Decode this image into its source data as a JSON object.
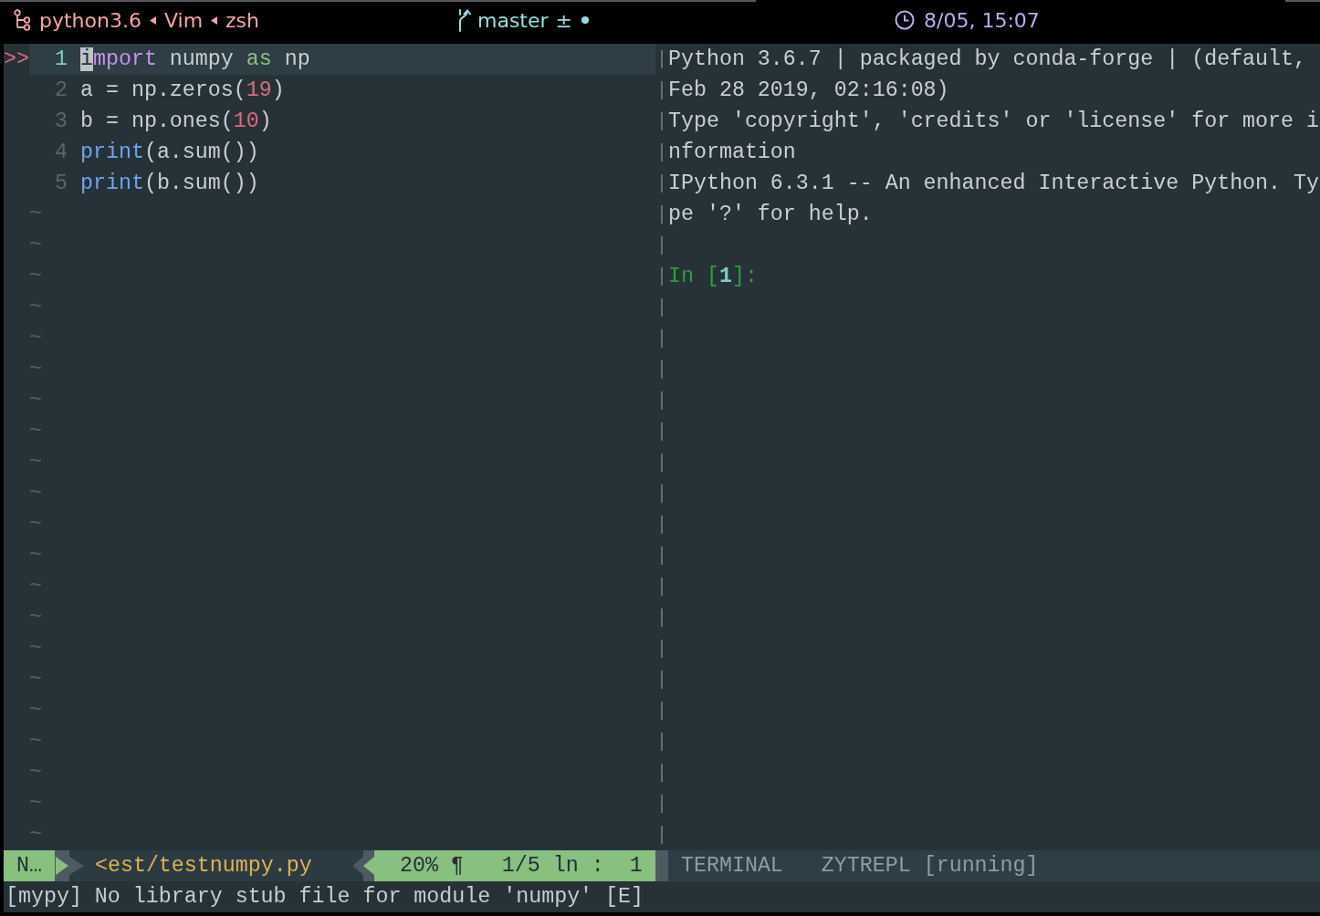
{
  "tmux_bar": {
    "process_chain": [
      "python3.6",
      "Vim",
      "zsh"
    ],
    "git": {
      "branch": "master",
      "status": "±",
      "changes_dot": true
    },
    "clock": "8/05, 15:07"
  },
  "editor": {
    "lines": [
      {
        "number": "1",
        "sign": ">>",
        "current": true,
        "tokens": [
          {
            "text": "i",
            "kind": "keyword",
            "cursor": true
          },
          {
            "text": "mport",
            "kind": "keyword",
            "cursor": false
          },
          {
            "text": " numpy ",
            "kind": "plain",
            "cursor": false
          },
          {
            "text": "as",
            "kind": "special",
            "cursor": false
          },
          {
            "text": " np",
            "kind": "plain",
            "cursor": false
          }
        ]
      },
      {
        "number": "2",
        "current": false,
        "tokens": [
          {
            "text": "a = np.zeros(",
            "kind": "plain",
            "cursor": false
          },
          {
            "text": "19",
            "kind": "number",
            "cursor": false
          },
          {
            "text": ")",
            "kind": "plain",
            "cursor": false
          }
        ]
      },
      {
        "number": "3",
        "current": false,
        "tokens": [
          {
            "text": "b = np.ones(",
            "kind": "plain",
            "cursor": false
          },
          {
            "text": "10",
            "kind": "number",
            "cursor": false
          },
          {
            "text": ")",
            "kind": "plain",
            "cursor": false
          }
        ]
      },
      {
        "number": "4",
        "current": false,
        "tokens": [
          {
            "text": "print",
            "kind": "builtin",
            "cursor": false
          },
          {
            "text": "(a.sum())",
            "kind": "plain",
            "cursor": false
          }
        ]
      },
      {
        "number": "5",
        "current": false,
        "tokens": [
          {
            "text": "print",
            "kind": "builtin",
            "cursor": false
          },
          {
            "text": "(b.sum())",
            "kind": "plain",
            "cursor": false
          }
        ]
      }
    ],
    "empty_lines": [
      "~",
      "~",
      "~",
      "~",
      "~",
      "~",
      "~",
      "~",
      "~",
      "~",
      "~",
      "~",
      "~",
      "~",
      "~",
      "~",
      "~",
      "~",
      "~",
      "~",
      "~"
    ]
  },
  "terminal": {
    "output": [
      "Python 3.6.7 | packaged by conda-forge | (default,",
      "Feb 28 2019, 02:16:08)",
      "Type 'copyright', 'credits' or 'license' for more i",
      "nformation",
      "IPython 6.3.1 -- An enhanced Interactive Python. Ty",
      "pe '?' for help."
    ],
    "prompt": {
      "prefix": "In [",
      "number": "1",
      "suffix": "]:"
    }
  },
  "status_line": {
    "mode": "N…",
    "file": "<est/testnumpy.py",
    "position": "20% ¶   1/5 ln :  1"
  },
  "terminal_status": {
    "type": "TERMINAL",
    "name": "ZYTREPL [running]"
  },
  "message": "[mypy] No library stub file for module 'numpy' [E]"
}
